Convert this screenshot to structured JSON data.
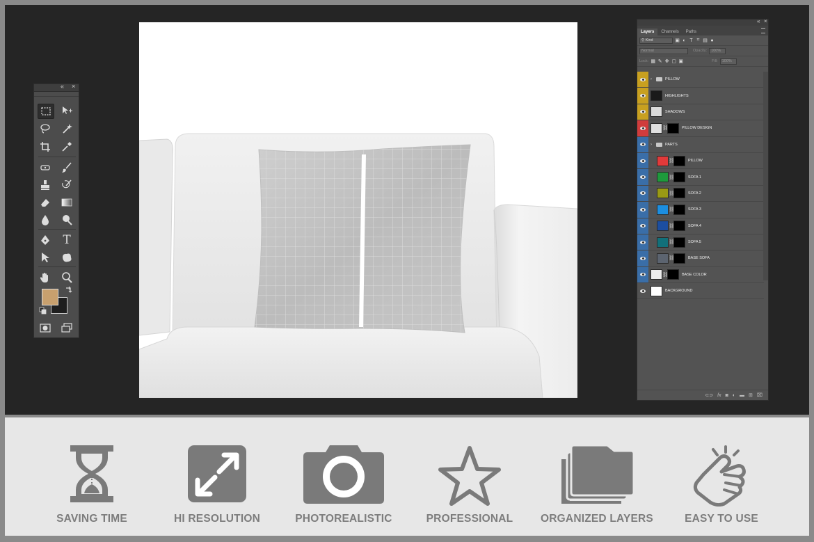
{
  "layers_panel": {
    "tabs": [
      "Layers",
      "Channels",
      "Paths"
    ],
    "filter": "Kind",
    "blend_mode": "Normal",
    "opacity_label": "Opacity:",
    "opacity_value": "100%",
    "lock_label": "Lock:",
    "fill_label": "Fill:",
    "fill_value": "100%",
    "layers": [
      {
        "name": "PILLOW",
        "type": "group",
        "eye_color": "#c8a020",
        "thumb": "",
        "mask": false
      },
      {
        "name": "HIGHLIGHTS",
        "type": "layer",
        "eye_color": "#c8a020",
        "thumb": "#1a1a1a",
        "mask": false
      },
      {
        "name": "SHADOWS",
        "type": "layer",
        "eye_color": "#c8a020",
        "thumb": "#dcdcdc",
        "mask": false
      },
      {
        "name": "PILLOW DESIGN",
        "type": "layer",
        "eye_color": "#d03c3c",
        "thumb": "#e0e0e0",
        "mask": true
      },
      {
        "name": "PARTS",
        "type": "group",
        "eye_color": "#3a6ea8",
        "thumb": "",
        "mask": false
      },
      {
        "name": "PILLOW",
        "type": "layer",
        "eye_color": "#3a6ea8",
        "thumb": "#e13a3a",
        "mask": true
      },
      {
        "name": "SOFA 1",
        "type": "layer",
        "eye_color": "#3a6ea8",
        "thumb": "#1e9a3c",
        "mask": true
      },
      {
        "name": "SOFA 2",
        "type": "layer",
        "eye_color": "#3a6ea8",
        "thumb": "#9a9a14",
        "mask": true
      },
      {
        "name": "SOFA 3",
        "type": "layer",
        "eye_color": "#3a6ea8",
        "thumb": "#1c8ee0",
        "mask": true
      },
      {
        "name": "SOFA 4",
        "type": "layer",
        "eye_color": "#3a6ea8",
        "thumb": "#1c4ea0",
        "mask": true
      },
      {
        "name": "SOFA 5",
        "type": "layer",
        "eye_color": "#3a6ea8",
        "thumb": "#12707a",
        "mask": true
      },
      {
        "name": "BASE SOFA",
        "type": "layer",
        "eye_color": "#3a6ea8",
        "thumb": "#5c6470",
        "mask": true
      },
      {
        "name": "BASE COLOR",
        "type": "layer",
        "eye_color": "#3a6ea8",
        "thumb": "#ececec",
        "mask": true
      },
      {
        "name": "BACKGROUND",
        "type": "layer",
        "eye_color": "#535353",
        "thumb": "#ffffff",
        "mask": false
      }
    ],
    "footer_icons": [
      "link-icon",
      "fx-icon",
      "mask-icon",
      "adjustment-icon",
      "folder-icon",
      "new-layer-icon",
      "trash-icon"
    ]
  },
  "tools_panel": {
    "collapse_glyph": "«",
    "close_glyph": "×",
    "foreground_color": "#c8a06e",
    "background_color": "#1e1e1e",
    "text_tool_glyph": "T"
  },
  "features": [
    {
      "label": "SAVING TIME",
      "icon": "hourglass-icon"
    },
    {
      "label": "HI RESOLUTION",
      "icon": "expand-arrows-icon"
    },
    {
      "label": "PHOTOREALISTIC",
      "icon": "camera-icon"
    },
    {
      "label": "PROFESSIONAL",
      "icon": "star-icon"
    },
    {
      "label": "ORGANIZED LAYERS",
      "icon": "folders-icon"
    },
    {
      "label": "EASY TO USE",
      "icon": "pointing-hand-icon"
    }
  ],
  "colors": {
    "frame": "#8a8a8a",
    "workspace": "#252525",
    "panel": "#535353",
    "strip": "#e7e7e7",
    "feature_gray": "#7a7a7a"
  }
}
